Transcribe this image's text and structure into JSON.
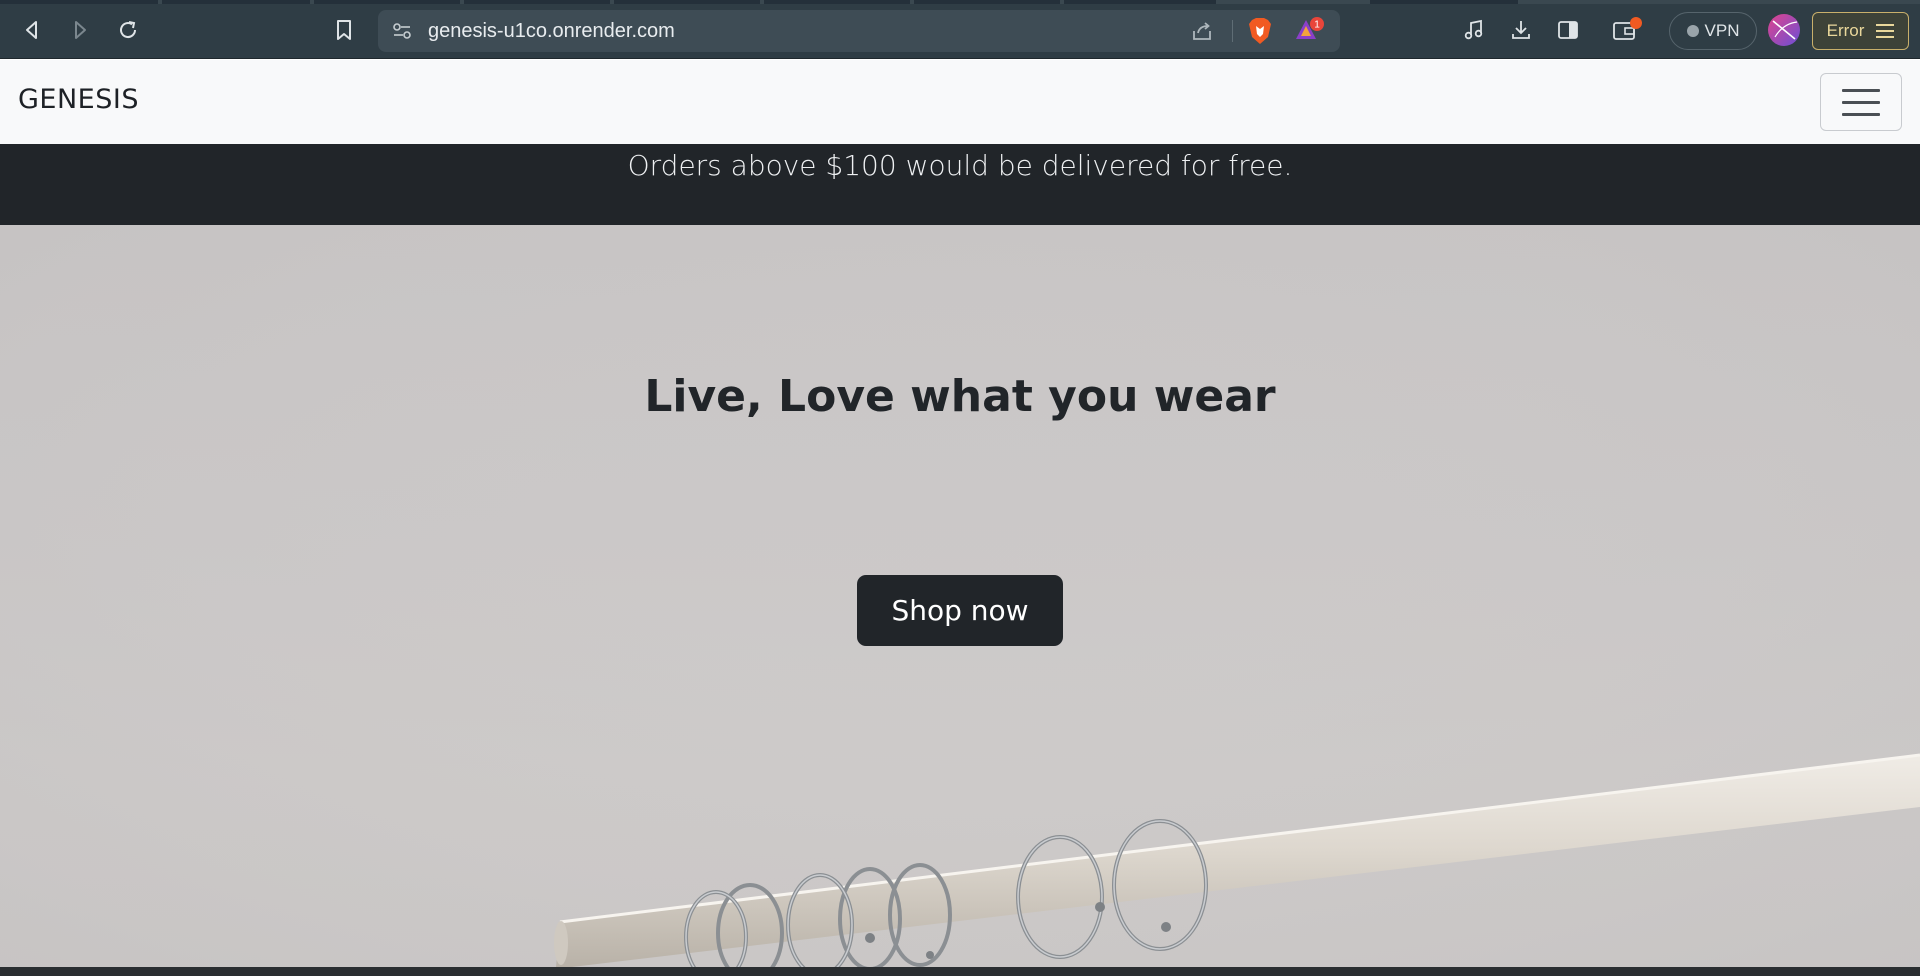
{
  "browser": {
    "url": "genesis-u1co.onrender.com",
    "vpn_label": "VPN",
    "error_label": "Error",
    "notification_count": "1",
    "icons": [
      "back-icon",
      "forward-icon",
      "reload-icon",
      "bookmark-icon",
      "site-settings-icon",
      "share-icon",
      "brave-shields-icon",
      "brave-rewards-icon",
      "media-icon",
      "download-icon",
      "sidebar-icon",
      "wallet-icon",
      "profile-icon",
      "menu-icon"
    ]
  },
  "site": {
    "brand": "GENESIS",
    "promo": "Orders above $100 would be delivered for free.",
    "hero_title": "Live, Love what you wear",
    "cta_label": "Shop now"
  },
  "colors": {
    "navbar_bg": "#f8f9fa",
    "dark": "#212529",
    "hero_bg": "#cbc8c8",
    "brave_orange": "#f15a22"
  }
}
